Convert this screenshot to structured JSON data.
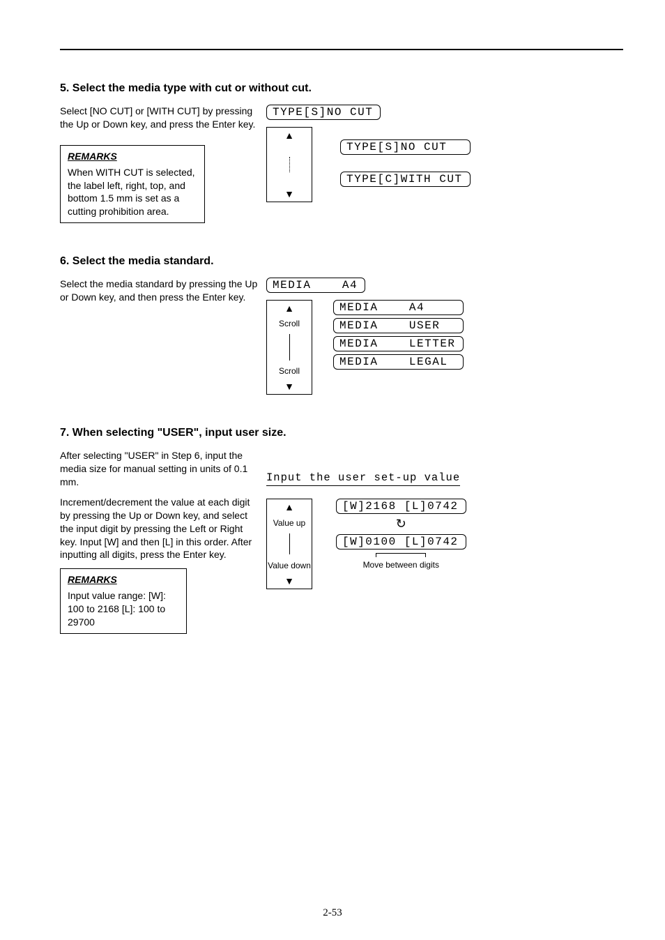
{
  "page_number": "2-53",
  "section1": {
    "title": "5. Select the media type with cut or without cut.",
    "body": "Select [NO CUT] or [WITH CUT] by pressing the Up or Down key, and press the Enter key.",
    "remarks_title": "REMARKS",
    "remarks_body": "When WITH CUT is selected, the label left, right, top, and bottom 1.5 mm is set as a cutting prohibition area.",
    "lcd_header": "TYPE[S]NO CUT",
    "scroll_top": "",
    "scroll_bottom": "",
    "option_a": "TYPE[S]NO CUT",
    "option_b": "TYPE[C]WITH CUT"
  },
  "section2": {
    "title": "6. Select the media standard.",
    "body": "Select the media standard by pressing the Up or Down key, and then press the Enter key.",
    "lcd_header": "MEDIA    A4",
    "scroll_top": "Scroll",
    "scroll_bottom": "Scroll",
    "opt1": "MEDIA    A4",
    "opt2": "MEDIA    USER",
    "opt3": "MEDIA    LETTER",
    "opt4": "MEDIA    LEGAL"
  },
  "section3": {
    "title": "7. When selecting \"USER\", input user size.",
    "body1": "After selecting \"USER\" in Step 6, input the media size for manual setting in units of 0.1 mm.",
    "body2": "Increment/decrement the value at each digit by pressing the Up or Down key, and select the input digit by pressing the Left or Right key. Input [W] and then [L] in this order. After inputting all digits, press the Enter key.",
    "remarks_title": "REMARKS",
    "remarks_body": "Input value range: [W]: 100 to 2168 [L]: 100 to 29700",
    "val_title": "Input the user set-up value",
    "scroll_top": "Value up",
    "scroll_bottom": "Value down",
    "lcd_top": "[W]2168 [L]0742",
    "lcd_bottom": "[W]0100 [L]0742",
    "flip_label": "Move between digits"
  }
}
